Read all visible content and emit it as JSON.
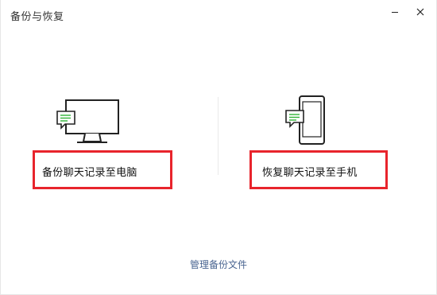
{
  "window": {
    "title": "备份与恢复"
  },
  "options": {
    "backup_to_pc": "备份聊天记录至电脑",
    "restore_to_phone": "恢复聊天记录至手机"
  },
  "footer": {
    "manage_link": "管理备份文件"
  },
  "colors": {
    "highlight": "#e8242c",
    "chat_bubble_green": "#2fb336",
    "link": "#4a6591"
  },
  "icons": [
    "minimize-icon",
    "close-icon",
    "computer-with-chat-icon",
    "phone-with-chat-icon"
  ]
}
